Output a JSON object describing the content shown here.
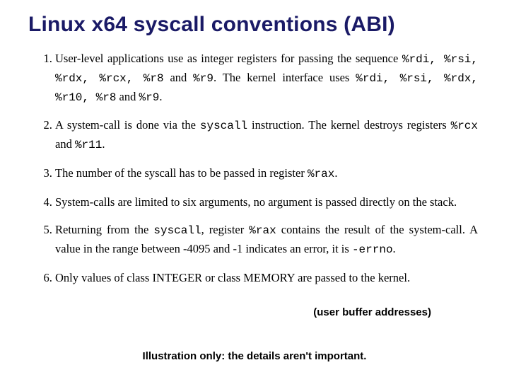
{
  "title": "Linux x64 syscall conventions (ABI)",
  "items": {
    "p1a": "User-level applications use as integer registers for passing the sequence ",
    "p1regs1": "%rdi, %rsi, %rdx, %rcx, %r8",
    "p1b": " and ",
    "p1regs2": "%r9",
    "p1c": ". The kernel interface uses ",
    "p1regs3": "%rdi, %rsi, %rdx, %r10, %r8",
    "p1d": " and ",
    "p1regs4": "%r9",
    "p1e": ".",
    "p2a": "A system-call is done via the ",
    "p2m1": "syscall",
    "p2b": " instruction. The kernel destroys registers ",
    "p2m2": "%rcx",
    "p2c": " and ",
    "p2m3": "%r11",
    "p2d": ".",
    "p3a": "The number of the syscall has to be passed in register ",
    "p3m1": "%rax",
    "p3b": ".",
    "p4": "System-calls are limited to six arguments, no argument is passed directly on the stack.",
    "p5a": "Returning from the ",
    "p5m1": "syscall",
    "p5b": ", register ",
    "p5m2": "%rax",
    "p5c": " contains the result of the system-call. A value in the range between -4095 and -1 indicates an error, it is ",
    "p5m3": "-errno",
    "p5d": ".",
    "p6": "Only values of class INTEGER or class MEMORY are passed to the kernel."
  },
  "annotation": "(user buffer addresses)",
  "caption": "Illustration only: the details aren't important."
}
